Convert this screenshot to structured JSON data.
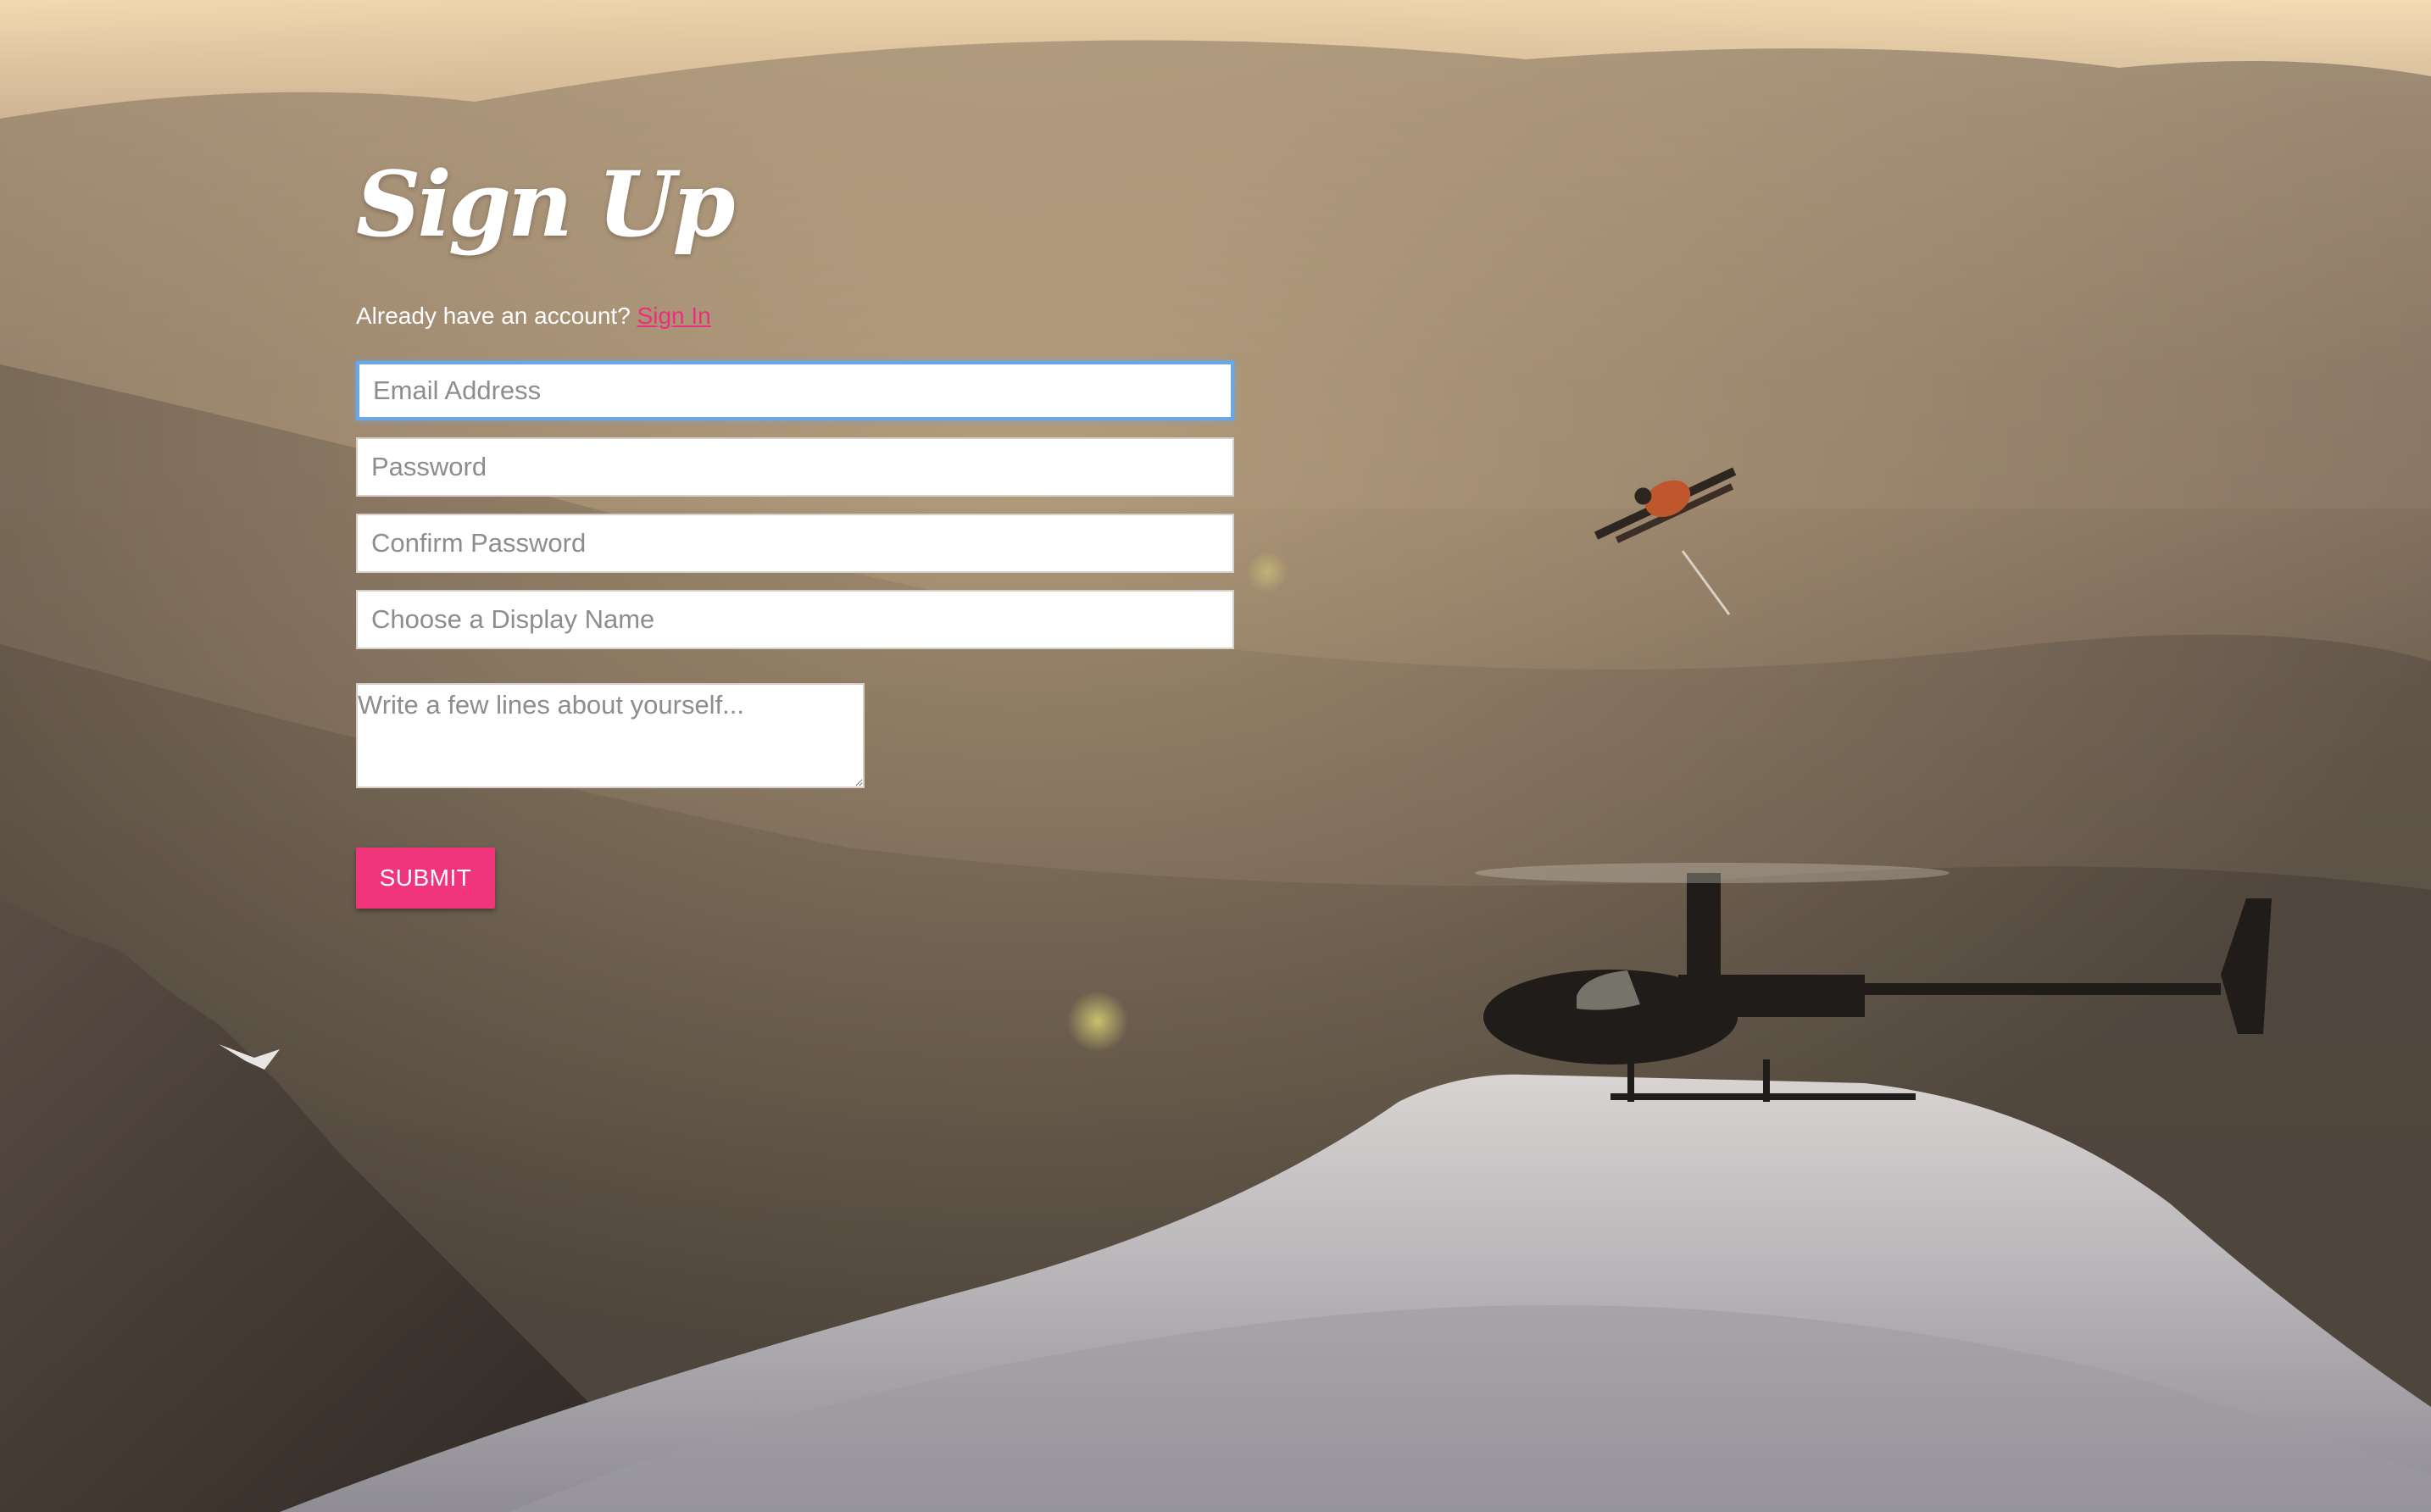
{
  "signup": {
    "title": "Sign Up",
    "account_prompt": "Already have an account?",
    "signin_link": "Sign In",
    "email_placeholder": "Email Address",
    "password_placeholder": "Password",
    "confirm_password_placeholder": "Confirm Password",
    "display_name_placeholder": "Choose a Display Name",
    "bio_placeholder": "Write a few lines about yourself...",
    "submit_label": "SUBMIT"
  },
  "colors": {
    "accent": "#f0357d",
    "link": "#ee2e7a",
    "focus_ring": "#6aa7e8"
  },
  "background": {
    "scene": "mountain sunset with helicopter on snowy ridge and airborne skier"
  }
}
